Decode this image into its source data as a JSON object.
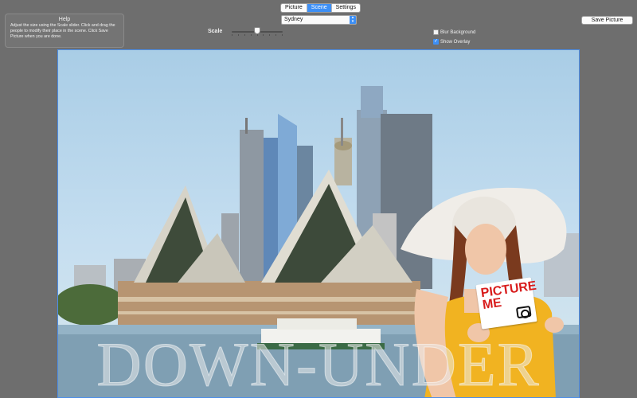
{
  "tabs": [
    {
      "label": "Picture",
      "active": false
    },
    {
      "label": "Scene",
      "active": true
    },
    {
      "label": "Settings",
      "active": false
    }
  ],
  "help": {
    "title": "Help",
    "text": "Adjust the size using the Scale slider. Click and drag the people to modify their place in the scene. Click Save Picture when you are done."
  },
  "scale": {
    "label": "Scale",
    "value": 0.5
  },
  "scene_select": {
    "value": "Sydney"
  },
  "options": {
    "blur_background": {
      "label": "Blur Background",
      "checked": false
    },
    "show_overlay": {
      "label": "Show Overlay",
      "checked": true
    }
  },
  "save_button": {
    "label": "Save Picture"
  },
  "scene": {
    "overlay_text": "DOWN-UNDER",
    "sign_line1": "PICTURE",
    "sign_line2": "ME"
  },
  "colors": {
    "accent": "#3d8ff5",
    "window_bg": "#6e6e6e",
    "sign_text": "#d81c1c"
  }
}
